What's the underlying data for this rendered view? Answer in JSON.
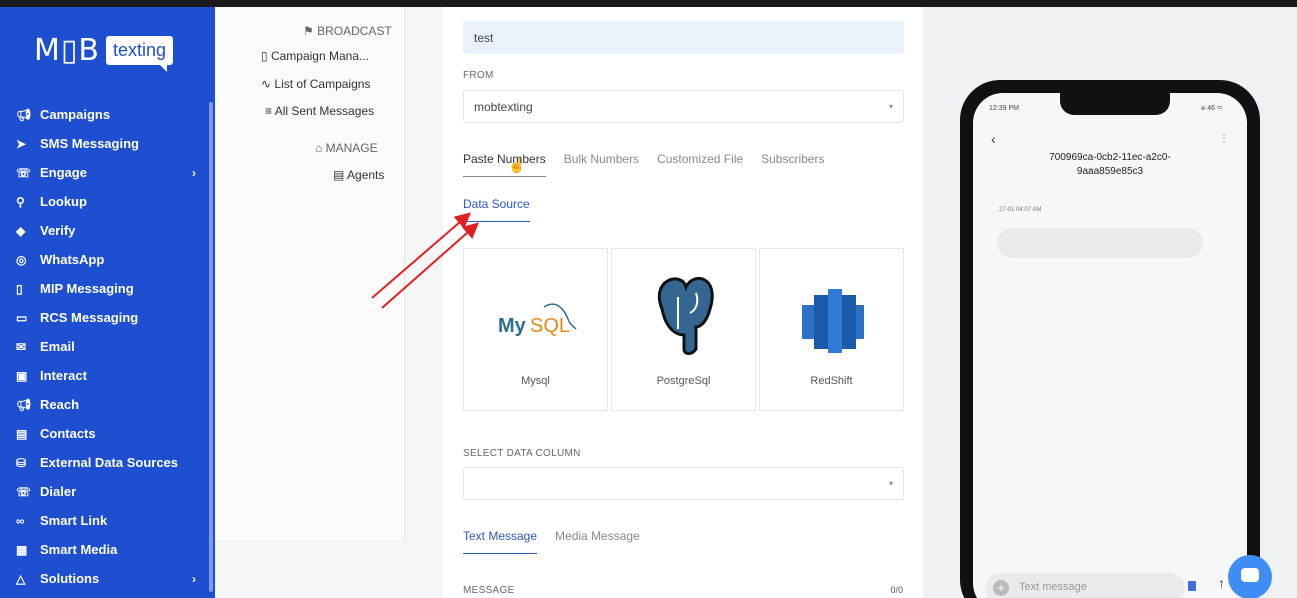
{
  "brand": {
    "logo_left": "M",
    "logo_right": "B",
    "logo_tag": "texting"
  },
  "sidebar": {
    "items": [
      {
        "label": "Campaigns",
        "icon": "megaphone-icon"
      },
      {
        "label": "SMS Messaging",
        "icon": "send-icon"
      },
      {
        "label": "Engage",
        "icon": "phone-icon",
        "has_children": true
      },
      {
        "label": "Lookup",
        "icon": "search-icon"
      },
      {
        "label": "Verify",
        "icon": "verify-icon"
      },
      {
        "label": "WhatsApp",
        "icon": "whatsapp-icon"
      },
      {
        "label": "MIP Messaging",
        "icon": "mobile-icon"
      },
      {
        "label": "RCS Messaging",
        "icon": "chat-icon"
      },
      {
        "label": "Email",
        "icon": "mail-icon"
      },
      {
        "label": "Interact",
        "icon": "ticket-icon"
      },
      {
        "label": "Reach",
        "icon": "megaphone-icon"
      },
      {
        "label": "Contacts",
        "icon": "contacts-icon"
      },
      {
        "label": "External Data Sources",
        "icon": "database-icon"
      },
      {
        "label": "Dialer",
        "icon": "phone-icon"
      },
      {
        "label": "Smart Link",
        "icon": "link-icon"
      },
      {
        "label": "Smart Media",
        "icon": "media-icon"
      },
      {
        "label": "Solutions",
        "icon": "warning-icon",
        "has_children": true
      }
    ]
  },
  "subnav": {
    "broadcast": "BROADCAST",
    "campaign_manager": "Campaign Mana...",
    "list_of_campaigns": "List of Campaigns",
    "all_sent_messages": "All Sent Messages",
    "manage": "MANAGE",
    "agents": "Agents"
  },
  "form": {
    "campaign_name_value": "test",
    "from_label": "FROM",
    "from_value": "mobtexting",
    "recipient_tabs": [
      "Paste Numbers",
      "Bulk Numbers",
      "Customized File",
      "Subscribers"
    ],
    "data_source_tab": "Data Source",
    "data_sources": [
      {
        "label": "Mysql",
        "logo": "mysql-logo"
      },
      {
        "label": "PostgreSql",
        "logo": "postgresql-logo"
      },
      {
        "label": "RedShift",
        "logo": "redshift-logo"
      }
    ],
    "select_column_label": "SELECT DATA COLUMN",
    "message_tabs": [
      "Text Message",
      "Media Message"
    ],
    "message_label": "MESSAGE",
    "message_count": "0/0"
  },
  "preview": {
    "time": "12:39 PM",
    "status": "46",
    "thread_id": "700969ca-0cb2-11ec-a2c0-9aaa859e85c3",
    "timestamp": "27-01 04:07 AM",
    "input_placeholder": "Text message"
  },
  "colors": {
    "sidebar": "#1d4fd0",
    "accent": "#2b56c8",
    "annotation": "#e02020"
  }
}
